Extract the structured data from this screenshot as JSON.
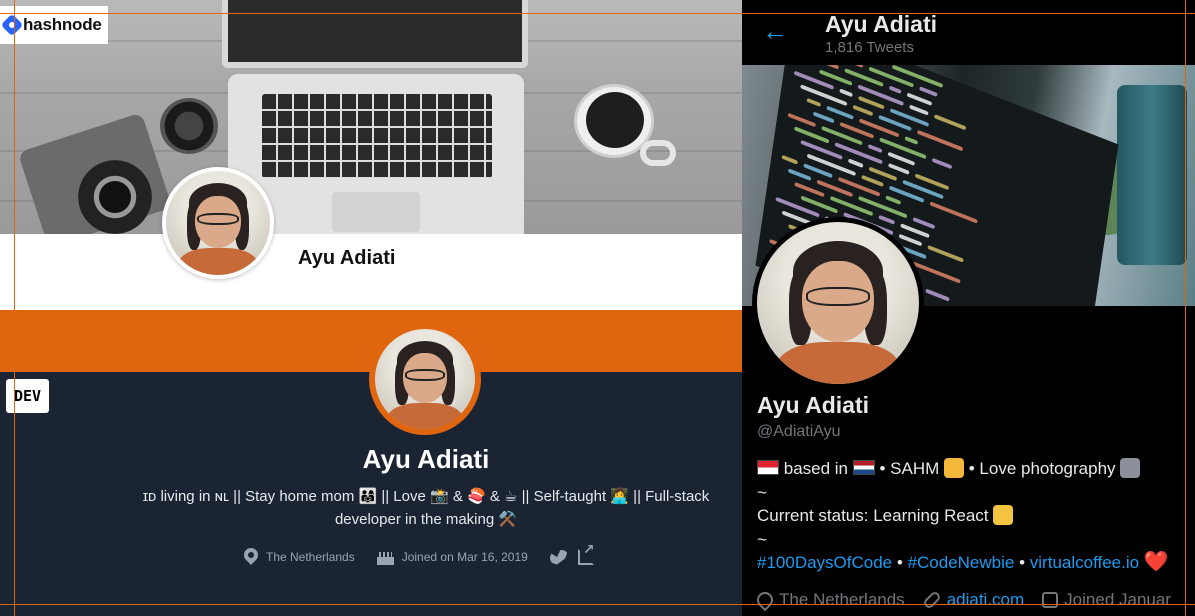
{
  "hashnode": {
    "logo_text": "hashnode",
    "name": "Ayu Adiati"
  },
  "dev": {
    "logo_text": "DEV",
    "name": "Ayu Adiati",
    "bio_line1": "ɪᴅ living in ɴʟ || Stay home mom 👨‍👩‍👧 || Love 📸 & 🍣 & ☕ || Self-taught 👩‍💻 || Full-stack",
    "bio_line2": "developer in the making ⚒️",
    "location": "The Netherlands",
    "joined": "Joined on Mar 16, 2019",
    "colors": {
      "band": "#e0650f",
      "background": "#1b2433"
    }
  },
  "twitter": {
    "header_title": "Ayu Adiati",
    "tweet_count": "1,816 Tweets",
    "name": "Ayu Adiati",
    "handle": "@AdiatiAyu",
    "bio": {
      "based_in": "based in",
      "sahm": "• SAHM",
      "love_photography": "• Love photography",
      "tilde1": "~",
      "status": "Current status: Learning React",
      "tilde2": "~",
      "tag1": "#100DaysOfCode",
      "sep1": "•",
      "tag2": "#CodeNewbie",
      "sep2": "•",
      "site": "virtualcoffee.io",
      "heart": "❤️"
    },
    "meta": {
      "location": "The Netherlands",
      "website": "adiati.com",
      "joined": "Joined Januar"
    },
    "colors": {
      "accent": "#1d9bf0",
      "text": "#e7e9ea",
      "muted": "#71767b"
    }
  }
}
